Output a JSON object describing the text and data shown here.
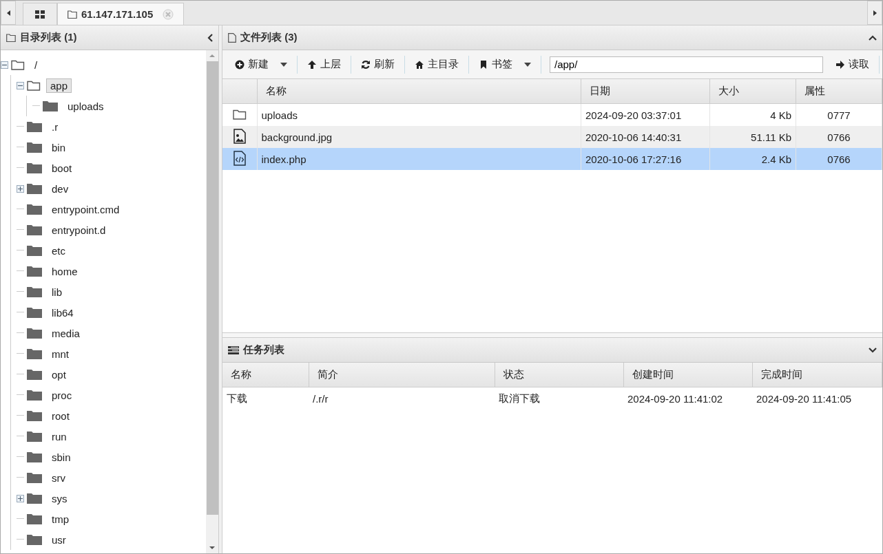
{
  "tabs": [
    {
      "kind": "home",
      "selected": false
    },
    {
      "kind": "folder",
      "label": "61.147.171.105",
      "selected": true
    }
  ],
  "directory_panel": {
    "title": "目录列表 (1)",
    "tree": [
      {
        "label": "/",
        "expanded": true,
        "selected": false,
        "children": [
          {
            "label": "app",
            "expanded": true,
            "selected": true,
            "children": [
              {
                "label": "uploads",
                "selected": false
              }
            ]
          },
          {
            "label": ".r",
            "selected": false
          },
          {
            "label": "bin",
            "selected": false
          },
          {
            "label": "boot",
            "selected": false
          },
          {
            "label": "dev",
            "expanded": false,
            "selected": false
          },
          {
            "label": "entrypoint.cmd",
            "selected": false
          },
          {
            "label": "entrypoint.d",
            "selected": false
          },
          {
            "label": "etc",
            "selected": false
          },
          {
            "label": "home",
            "selected": false
          },
          {
            "label": "lib",
            "selected": false
          },
          {
            "label": "lib64",
            "selected": false
          },
          {
            "label": "media",
            "selected": false
          },
          {
            "label": "mnt",
            "selected": false
          },
          {
            "label": "opt",
            "selected": false
          },
          {
            "label": "proc",
            "selected": false
          },
          {
            "label": "root",
            "selected": false
          },
          {
            "label": "run",
            "selected": false
          },
          {
            "label": "sbin",
            "selected": false
          },
          {
            "label": "srv",
            "selected": false
          },
          {
            "label": "sys",
            "expanded": false,
            "selected": false
          },
          {
            "label": "tmp",
            "selected": false
          },
          {
            "label": "usr",
            "selected": false
          }
        ]
      }
    ]
  },
  "file_panel": {
    "title": "文件列表 (3)",
    "toolbar": [
      {
        "kind": "new",
        "label": "新建",
        "dropdown": true
      },
      {
        "kind": "up",
        "label": "上层",
        "dropdown": false
      },
      {
        "kind": "refresh",
        "label": "刷新",
        "dropdown": false
      },
      {
        "kind": "home",
        "label": "主目录",
        "dropdown": false
      },
      {
        "kind": "bookmark",
        "label": "书签",
        "dropdown": true
      }
    ],
    "path": "/app/",
    "read_button": "读取",
    "columns": [
      "名称",
      "日期",
      "大小",
      "属性"
    ],
    "rows": [
      {
        "kind": "folder",
        "name": "uploads",
        "date": "2024-09-20 03:37:01",
        "size": "4 Kb",
        "permissions": "0777",
        "selected": false
      },
      {
        "kind": "image",
        "name": "background.jpg",
        "date": "2020-10-06 14:40:31",
        "size": "51.11 Kb",
        "permissions": "0766",
        "selected": false
      },
      {
        "kind": "code",
        "name": "index.php",
        "date": "2020-10-06 17:27:16",
        "size": "2.4 Kb",
        "permissions": "0766",
        "selected": true
      }
    ]
  },
  "task_panel": {
    "title": "任务列表",
    "columns": [
      "名称",
      "简介",
      "状态",
      "创建时间",
      "完成时间"
    ],
    "rows": [
      [
        "下载",
        "/.r/r",
        "取消下载",
        "2024-09-20 11:41:02",
        "2024-09-20 11:41:05"
      ]
    ]
  }
}
